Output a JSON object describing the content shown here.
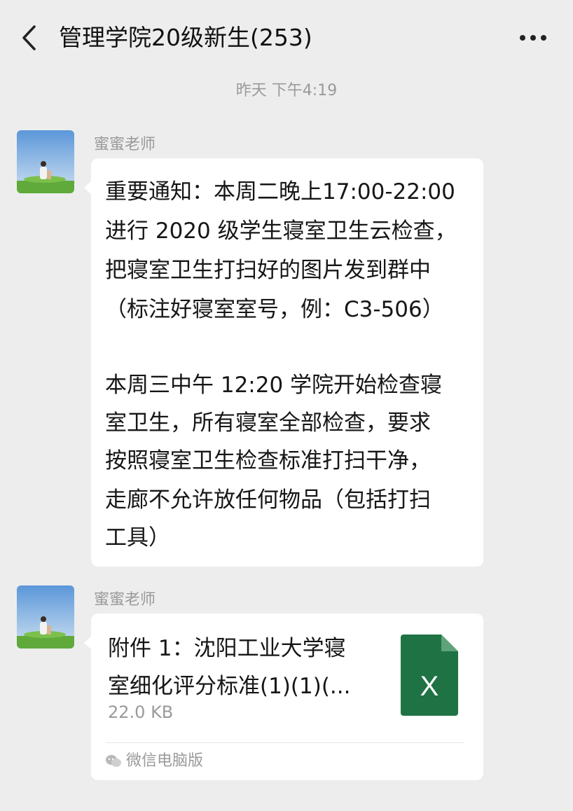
{
  "header": {
    "title": "管理学院20级新生(253)",
    "back_icon": "chevron-left-icon",
    "more_icon": "more-dots-icon"
  },
  "timestamp": "昨天 下午4:19",
  "messages": [
    {
      "sender": "蜜蜜老师",
      "lines": [
        "重要通知：本周二晚上17:00-22:00",
        "进行 2020 级学生寝室卫生云检查，",
        "把寝室卫生打扫好的图片发到群中",
        "（标注好寝室室号，例：C3-506）",
        "本周三中午 12:20 学院开始检查寝",
        "室卫生，所有寝室全部检查，要求",
        "按照寝室卫生检查标准打扫干净，",
        "走廊不允许放任何物品（包括打扫",
        "工具）"
      ]
    },
    {
      "sender": "蜜蜜老师",
      "file": {
        "name_lines": [
          "附件 1：沈阳工业大学寝",
          "室细化评分标准(1)(1)(..."
        ],
        "size": "22.0 KB",
        "icon_letter": "X",
        "icon_color": "#1f7244",
        "source": "微信电脑版"
      }
    }
  ]
}
